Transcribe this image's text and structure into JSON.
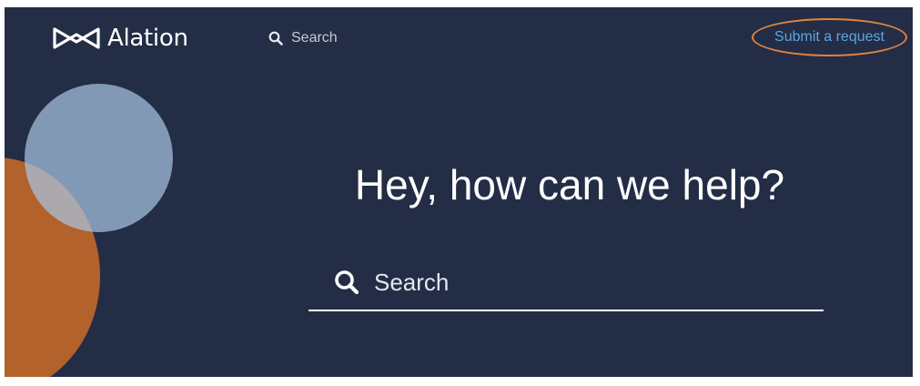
{
  "header": {
    "logo_text": "Alation",
    "search_placeholder": "Search",
    "submit_request_label": "Submit a request"
  },
  "hero": {
    "headline": "Hey, how can we help?",
    "search_placeholder": "Search"
  },
  "colors": {
    "background": "#232d45",
    "accent_orange": "#b3622c",
    "accent_blue": "#a8c4e0",
    "link_blue": "#5ea5e0",
    "highlight_ring": "#e08340"
  },
  "icons": {
    "logo": "alation-bowtie-icon",
    "search": "search-icon"
  }
}
